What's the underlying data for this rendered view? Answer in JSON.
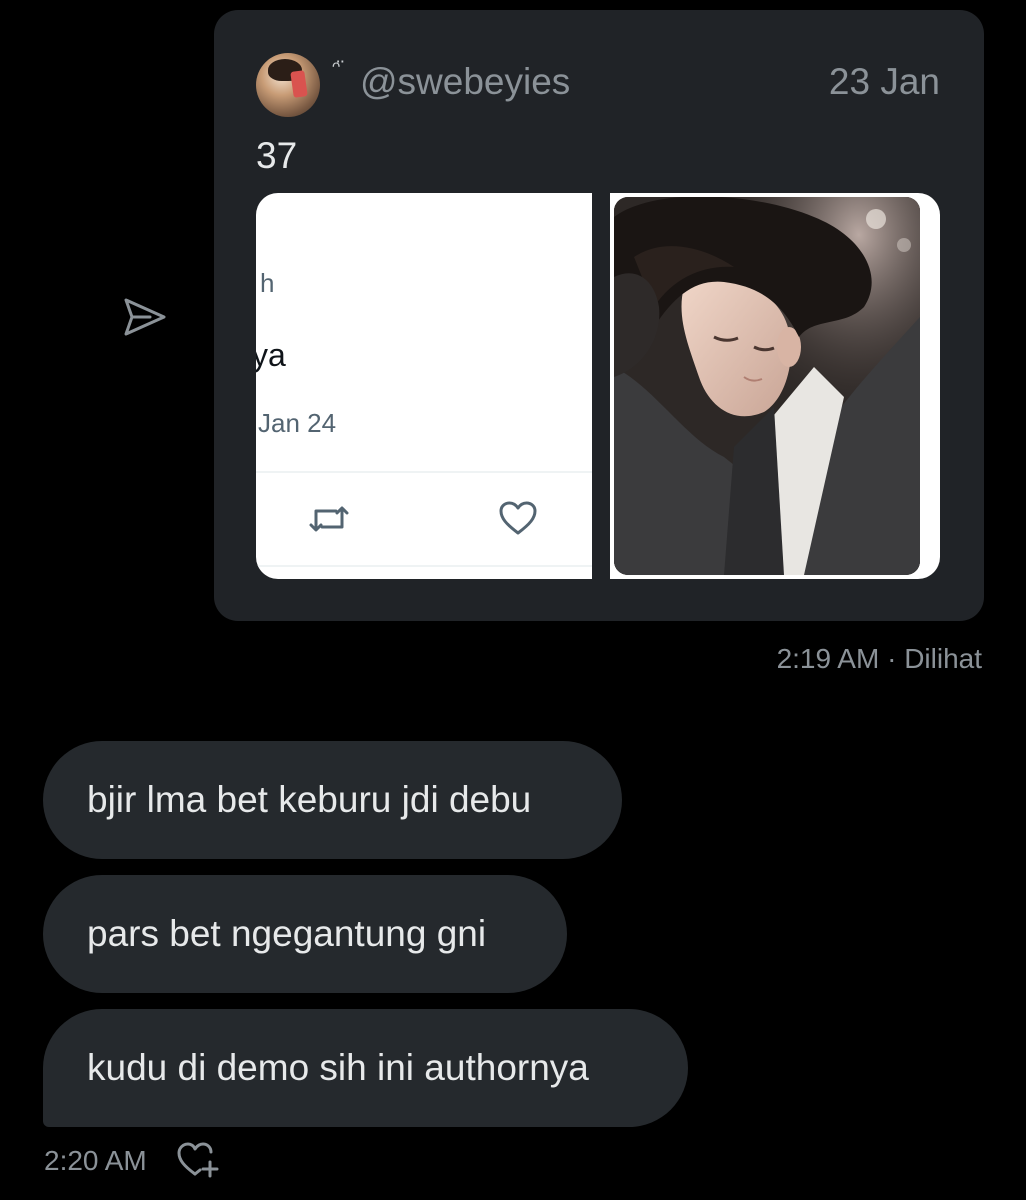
{
  "shared_tweet": {
    "handle": "@swebeyies",
    "emoji": "ᵔ̈",
    "date": "23 Jan",
    "text": "37",
    "media_left": {
      "fragment_h": "h",
      "fragment_ya": "ya",
      "date": "Jan 24"
    }
  },
  "sent_meta": "2:19 AM · Dilihat",
  "received_messages": [
    "bjir lma bet keburu jdi debu",
    "pars bet ngegantung gni",
    "kudu di demo sih ini authornya"
  ],
  "received_meta": "2:20 AM",
  "icons": {
    "share": "send-icon",
    "retweet": "retweet-icon",
    "like": "heart-icon",
    "react": "add-reaction-icon"
  },
  "colors": {
    "background": "#000000",
    "card": "#202327",
    "bubble": "#25292d",
    "muted_text": "#8b9298",
    "text": "#e7e9ea"
  }
}
